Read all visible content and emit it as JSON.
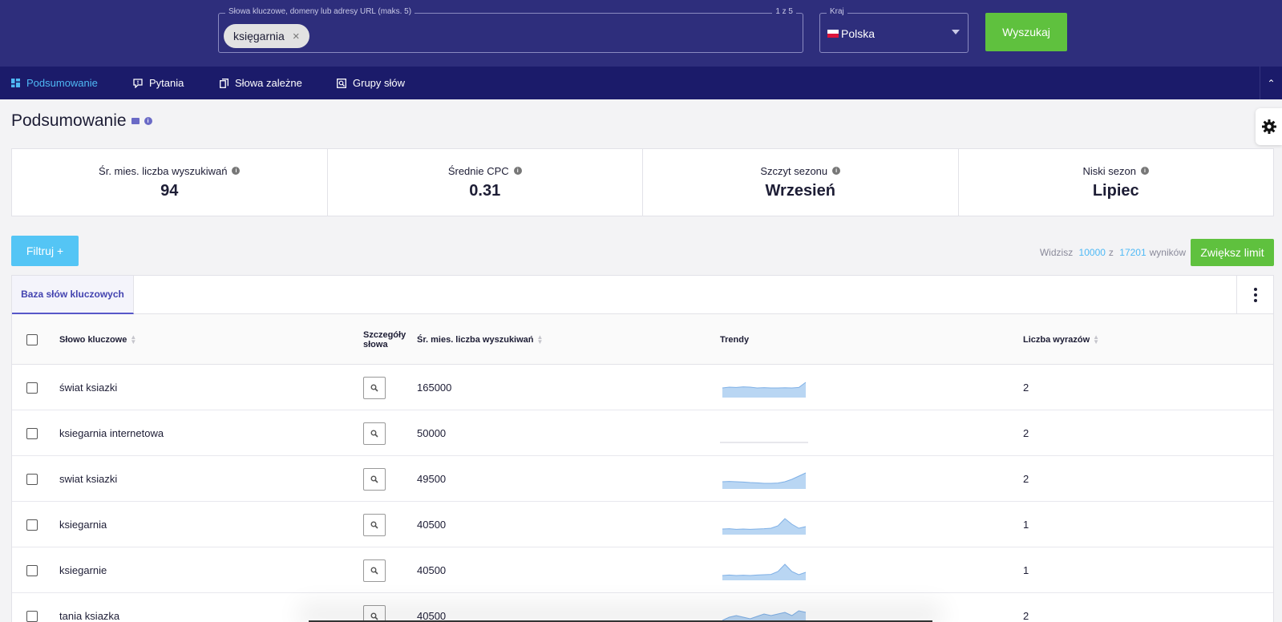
{
  "search": {
    "keywords_legend": "Słowa kluczowe, domeny lub adresy URL (maks. 5)",
    "keywords_counter": "1 z 5",
    "chip_label": "księgarnia",
    "chip_remove": "×",
    "country_legend": "Kraj",
    "country_value": "Polska",
    "search_button": "Wyszukaj"
  },
  "nav": {
    "items": [
      {
        "label": "Podsumowanie",
        "active": true
      },
      {
        "label": "Pytania"
      },
      {
        "label": "Słowa zależne"
      },
      {
        "label": "Grupy słów"
      }
    ],
    "collapse_icon": "chevron-up-icon"
  },
  "page": {
    "title": "Podsumowanie"
  },
  "stats": [
    {
      "label": "Śr. mies. liczba wyszukiwań",
      "value": "94"
    },
    {
      "label": "Średnie CPC",
      "value": "0.31"
    },
    {
      "label": "Szczyt sezonu",
      "value": "Wrzesień"
    },
    {
      "label": "Niski sezon",
      "value": "Lipiec"
    }
  ],
  "toolbar": {
    "filter_button": "Filtruj +",
    "results_prefix": "Widzisz",
    "results_shown": "10000",
    "results_of": "z",
    "results_total": "17201",
    "results_suffix": "wyników",
    "limit_button": "Zwiększ limit"
  },
  "table": {
    "tab_label": "Baza słów kluczowych",
    "columns": {
      "keyword": "Słowo kluczowe",
      "details_line1": "Szczegóły",
      "details_line2": "słowa",
      "volume": "Śr. mies. liczba wyszukiwań",
      "trends": "Trendy",
      "word_count": "Liczba wyrazów"
    },
    "rows": [
      {
        "keyword": "świat ksiazki",
        "volume": "165000",
        "word_count": "2",
        "trend": [
          0.55,
          0.6,
          0.58,
          0.62,
          0.6,
          0.55,
          0.57,
          0.55,
          0.55,
          0.56,
          0.55,
          0.58,
          0.9
        ]
      },
      {
        "keyword": "ksiegarnia internetowa",
        "volume": "50000",
        "word_count": "2",
        "trend": [
          0,
          0,
          0,
          0,
          0,
          0,
          0,
          0,
          0,
          0,
          0,
          0,
          0
        ]
      },
      {
        "keyword": "swiat ksiazki",
        "volume": "49500",
        "word_count": "2",
        "trend": [
          0.4,
          0.42,
          0.4,
          0.38,
          0.35,
          0.33,
          0.3,
          0.3,
          0.32,
          0.4,
          0.55,
          0.75,
          0.95
        ]
      },
      {
        "keyword": "ksiegarnia",
        "volume": "40500",
        "word_count": "1",
        "trend": [
          0.3,
          0.32,
          0.28,
          0.3,
          0.28,
          0.3,
          0.32,
          0.35,
          0.5,
          0.95,
          0.6,
          0.35,
          0.45
        ]
      },
      {
        "keyword": "ksiegarnie",
        "volume": "40500",
        "word_count": "1",
        "trend": [
          0.25,
          0.28,
          0.25,
          0.27,
          0.25,
          0.28,
          0.3,
          0.32,
          0.5,
          0.95,
          0.5,
          0.3,
          0.45
        ]
      },
      {
        "keyword": "tania ksiazka",
        "volume": "40500",
        "word_count": "2",
        "trend": [
          0.3,
          0.5,
          0.6,
          0.5,
          0.4,
          0.55,
          0.7,
          0.6,
          0.7,
          0.8,
          0.6,
          0.9,
          0.8
        ]
      }
    ]
  },
  "colors": {
    "topbar": "#2e2e7c",
    "nav": "#1b1b6a",
    "accent_blue": "#4fb9f5",
    "accent_green": "#5fc13e",
    "trend_fill": "#b9d6f3",
    "trend_line": "#7fb0e6"
  }
}
